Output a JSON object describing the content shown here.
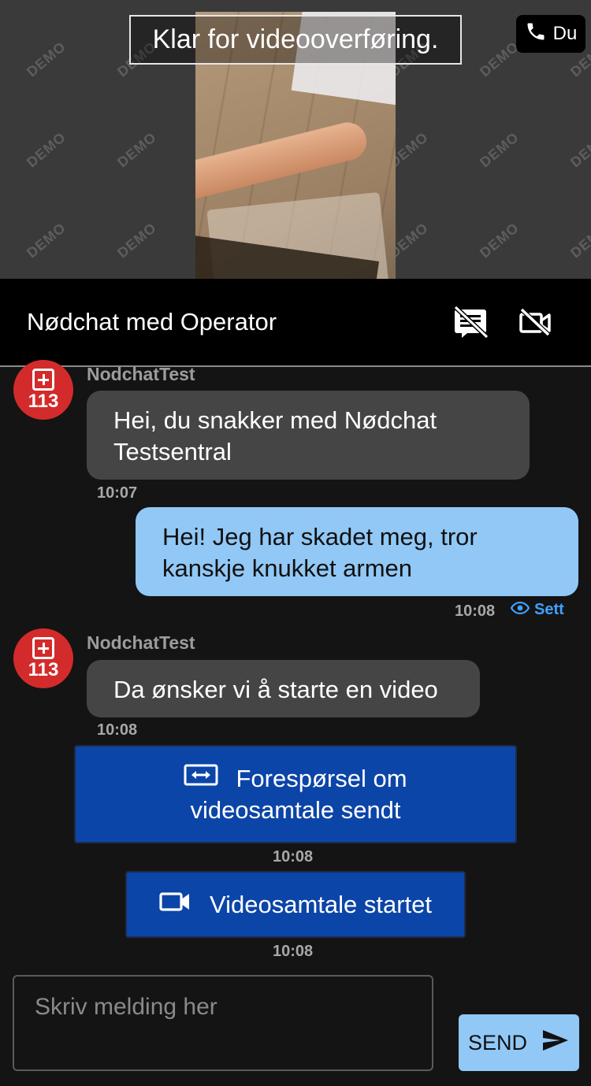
{
  "video": {
    "status_text": "Klar for videooverføring.",
    "watermark_text": "DEMO",
    "caller_label": "Du"
  },
  "header": {
    "title": "Nødchat med Operator",
    "icons": [
      "chat-off-icon",
      "video-off-icon"
    ]
  },
  "messages": [
    {
      "from": "operator",
      "sender": "NodchatTest",
      "text_lines": [
        "Hei, du snakker med Nødchat",
        "Testsentral"
      ],
      "time": "10:07"
    },
    {
      "from": "user",
      "text_lines": [
        "Hei! Jeg har skadet meg, tror",
        "kanskje knukket armen"
      ],
      "time": "10:08",
      "status": "Sett"
    },
    {
      "from": "operator",
      "sender": "NodchatTest",
      "text_lines": [
        "Da ønsker vi å starte en video"
      ],
      "time": "10:08"
    }
  ],
  "avatar_number": "113",
  "system_events": [
    {
      "icon": "video-switch-icon",
      "text_lines": [
        "Forespørsel om",
        "videosamtale sendt"
      ],
      "time": "10:08"
    },
    {
      "icon": "video-camera-icon",
      "text_lines": [
        "Videosamtale startet"
      ],
      "time": "10:08"
    }
  ],
  "composer": {
    "placeholder": "Skriv melding her",
    "send_label": "SEND"
  },
  "colors": {
    "background": "#141414",
    "incoming_bubble": "#454545",
    "outgoing_bubble": "#91c8f6",
    "system_box": "#0c45a8",
    "avatar": "#d32b2b",
    "seen": "#3ea2ff"
  }
}
